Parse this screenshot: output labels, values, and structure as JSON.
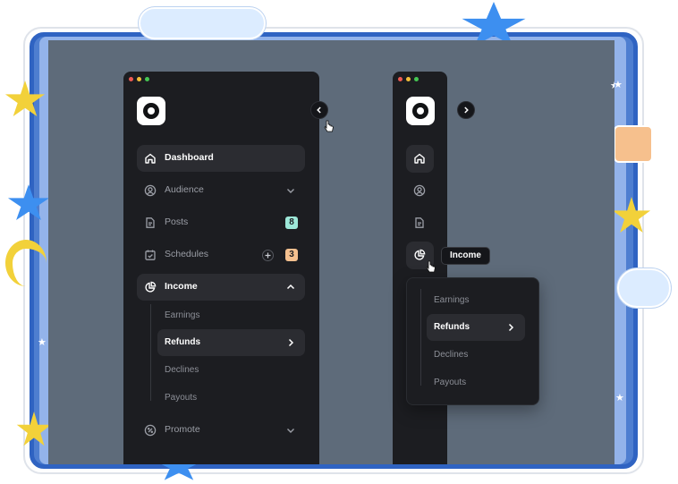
{
  "window_controls": [
    "close",
    "minimize",
    "maximize"
  ],
  "expanded_sidebar": {
    "logo": "app-logo",
    "collapse_icon": "chevron-left-icon",
    "nav": [
      {
        "label": "Dashboard",
        "icon": "home-icon",
        "active": true
      },
      {
        "label": "Audience",
        "icon": "user-circle-icon",
        "trailing": "chevron-down-icon"
      },
      {
        "label": "Posts",
        "icon": "document-icon",
        "badge": "8",
        "badge_color": "#9de7d8"
      },
      {
        "label": "Schedules",
        "icon": "calendar-check-icon",
        "badge": "3",
        "badge_color": "#f4c08f",
        "has_add": true
      },
      {
        "label": "Income",
        "icon": "pie-chart-icon",
        "active": true,
        "trailing": "chevron-up-icon"
      },
      {
        "label": "Promote",
        "icon": "percent-icon",
        "trailing": "chevron-down-icon"
      }
    ],
    "income_sub": [
      {
        "label": "Earnings"
      },
      {
        "label": "Refunds",
        "active": true,
        "trailing": "chevron-right-icon"
      },
      {
        "label": "Declines"
      },
      {
        "label": "Payouts"
      }
    ]
  },
  "collapsed_sidebar": {
    "expand_icon": "chevron-right-icon",
    "icons": [
      "home-icon",
      "user-circle-icon",
      "document-icon",
      "pie-chart-icon"
    ],
    "tooltip": "Income",
    "flyout": [
      {
        "label": "Earnings"
      },
      {
        "label": "Refunds",
        "active": true,
        "trailing": "chevron-right-icon"
      },
      {
        "label": "Declines"
      },
      {
        "label": "Payouts"
      }
    ]
  },
  "colors": {
    "panel": "#1c1d21",
    "active_item": "#2b2c31",
    "stage": "#5e6b7a",
    "frame_blue": "#2f63c2"
  }
}
